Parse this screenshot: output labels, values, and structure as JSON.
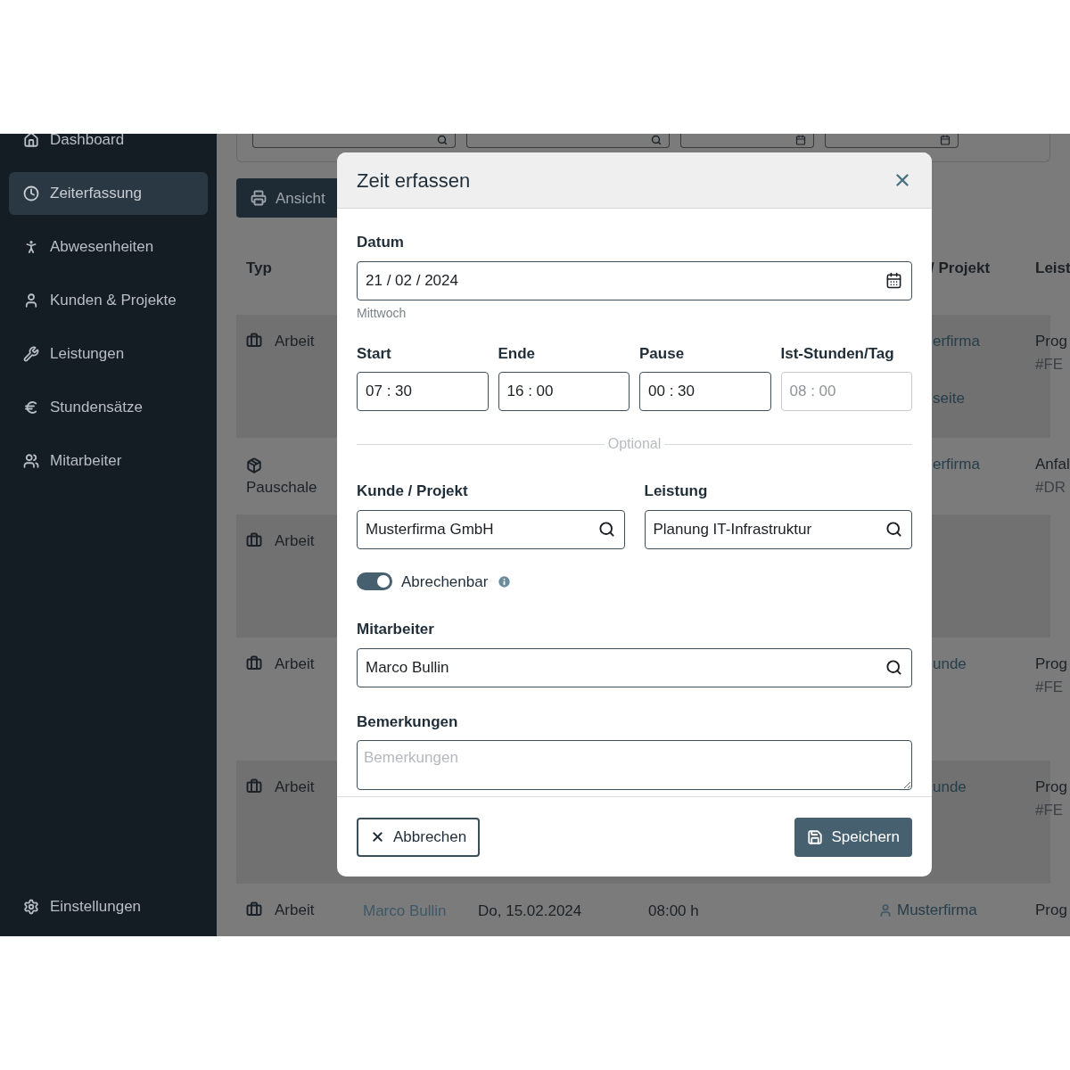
{
  "sidebar": {
    "items": [
      {
        "label": "Dashboard",
        "selected": false
      },
      {
        "label": "Zeiterfassung",
        "selected": true
      },
      {
        "label": "Abwesenheiten",
        "selected": false
      },
      {
        "label": "Kunden & Projekte",
        "selected": false
      },
      {
        "label": "Leistungen",
        "selected": false
      },
      {
        "label": "Stundensätze",
        "selected": false
      },
      {
        "label": "Mitarbeiter",
        "selected": false
      }
    ],
    "footer_item": {
      "label": "Einstellungen",
      "selected": false
    }
  },
  "filters": [
    {
      "kind": "search"
    },
    {
      "kind": "search"
    },
    {
      "kind": "date"
    },
    {
      "kind": "date"
    }
  ],
  "print_button": "Ansicht",
  "table": {
    "headers": {
      "type": "Typ",
      "project": "/ Projekt",
      "service": "Leist"
    },
    "rows": [
      {
        "kind": "work",
        "type": "Arbeit",
        "project": [
          "erfirma",
          "seite"
        ],
        "service": "Prog",
        "service_code": "#FE"
      },
      {
        "kind": "flat",
        "type": "Pauschale",
        "project": [
          "erfirma"
        ],
        "service": "Anfal",
        "service_code": "#DR"
      },
      {
        "kind": "work",
        "type": "Arbeit"
      },
      {
        "kind": "work",
        "type": "Arbeit",
        "project": [
          "unde"
        ],
        "service": "Prog",
        "service_code": "#FE"
      },
      {
        "kind": "work",
        "type": "Arbeit",
        "project": [
          "unde"
        ],
        "service": "Prog",
        "service_code": "#FE"
      },
      {
        "kind": "work",
        "type": "Arbeit",
        "employee": "Marco Bullin",
        "date": "Do, 15.02.2024",
        "duration": "08:00 h",
        "project": [
          "Musterfirma"
        ],
        "service": "Prog"
      }
    ]
  },
  "dialog": {
    "title": "Zeit erfassen",
    "date": {
      "label": "Datum",
      "value": "21 / 02 / 2024",
      "hint": "Mittwoch"
    },
    "times": [
      {
        "label": "Start",
        "value": "07 : 30",
        "disabled": false
      },
      {
        "label": "Ende",
        "value": "16 : 00",
        "disabled": false
      },
      {
        "label": "Pause",
        "value": "00 : 30",
        "disabled": false
      },
      {
        "label": "Ist-Stunden/Tag",
        "value": "08 : 00",
        "disabled": true
      }
    ],
    "divider": "Optional",
    "customer": {
      "label": "Kunde / Projekt",
      "value": "Musterfirma GmbH"
    },
    "service": {
      "label": "Leistung",
      "value": "Planung IT-Infrastruktur"
    },
    "billable": {
      "label": "Abrechenbar",
      "on": true
    },
    "employee": {
      "label": "Mitarbeiter",
      "value": "Marco Bullin"
    },
    "remarks": {
      "label": "Bemerkungen",
      "placeholder": "Bemerkungen"
    },
    "cancel": "Abbrechen",
    "save": "Speichern"
  }
}
